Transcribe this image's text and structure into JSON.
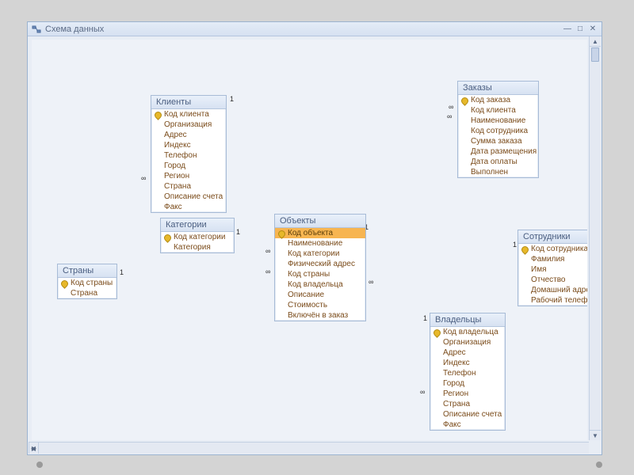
{
  "window": {
    "title": "Схема данных"
  },
  "tables": {
    "clients": {
      "title": "Клиенты",
      "fields": {
        "f0": "Код клиента",
        "f1": "Организация",
        "f2": "Адрес",
        "f3": "Индекс",
        "f4": "Телефон",
        "f5": "Город",
        "f6": "Регион",
        "f7": "Страна",
        "f8": "Описание счета",
        "f9": "Факс"
      }
    },
    "orders": {
      "title": "Заказы",
      "fields": {
        "f0": "Код заказа",
        "f1": "Код клиента",
        "f2": "Наименование",
        "f3": "Код сотрудника",
        "f4": "Сумма заказа",
        "f5": "Дата размещения",
        "f6": "Дата оплаты",
        "f7": "Выполнен"
      }
    },
    "categories": {
      "title": "Категории",
      "fields": {
        "f0": "Код категории",
        "f1": "Категория"
      }
    },
    "objects": {
      "title": "Объекты",
      "fields": {
        "f0": "Код объекта",
        "f1": "Наименование",
        "f2": "Код категории",
        "f3": "Физический адрес",
        "f4": "Код страны",
        "f5": "Код владельца",
        "f6": "Описание",
        "f7": "Стоимость",
        "f8": "Включён в заказ"
      }
    },
    "countries": {
      "title": "Страны",
      "fields": {
        "f0": "Код страны",
        "f1": "Страна"
      }
    },
    "employees": {
      "title": "Сотрудники",
      "fields": {
        "f0": "Код сотрудника",
        "f1": "Фамилия",
        "f2": "Имя",
        "f3": "Отчество",
        "f4": "Домашний адрес",
        "f5": "Рабочий телефон"
      }
    },
    "owners": {
      "title": "Владельцы",
      "fields": {
        "f0": "Код владельца",
        "f1": "Организация",
        "f2": "Адрес",
        "f3": "Индекс",
        "f4": "Телефон",
        "f5": "Город",
        "f6": "Регион",
        "f7": "Страна",
        "f8": "Описание счета",
        "f9": "Факс"
      }
    }
  },
  "relationships": [
    {
      "from": "clients.f0",
      "to": "orders.f1",
      "card_from": "1",
      "card_to": "∞"
    },
    {
      "from": "orders.f2",
      "to": "objects.f0",
      "card_from": "∞",
      "card_to": "1"
    },
    {
      "from": "employees.f0",
      "to": "orders.f3",
      "card_from": "1",
      "card_to": "∞"
    },
    {
      "from": "categories.f0",
      "to": "objects.f2",
      "card_from": "1",
      "card_to": "∞"
    },
    {
      "from": "countries.f0",
      "to": "objects.f4",
      "card_from": "1",
      "card_to": "∞"
    },
    {
      "from": "countries.f0",
      "to": "clients.f7",
      "card_from": "1",
      "card_to": "∞"
    },
    {
      "from": "countries.f0",
      "to": "owners.f7",
      "card_from": "1",
      "card_to": "∞"
    },
    {
      "from": "owners.f0",
      "to": "objects.f5",
      "card_from": "1",
      "card_to": "∞"
    }
  ],
  "cardinality_symbols": {
    "one": "1",
    "many": "∞"
  }
}
